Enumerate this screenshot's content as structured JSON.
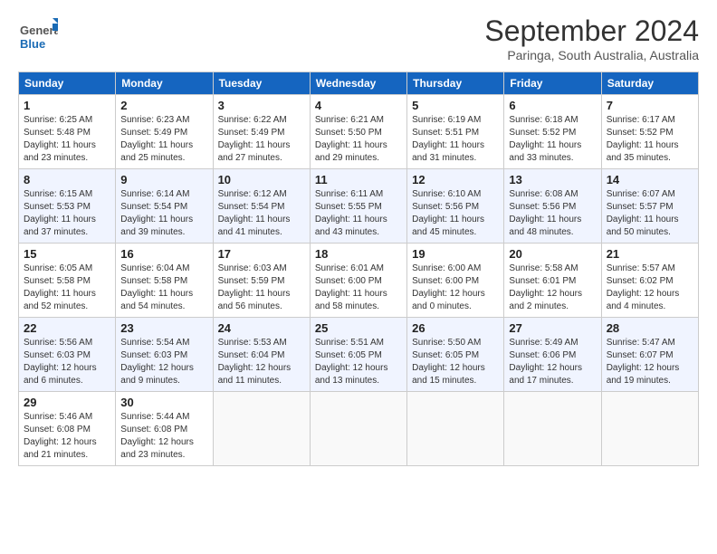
{
  "header": {
    "logo_general": "General",
    "logo_blue": "Blue",
    "month": "September 2024",
    "location": "Paringa, South Australia, Australia"
  },
  "days_of_week": [
    "Sunday",
    "Monday",
    "Tuesday",
    "Wednesday",
    "Thursday",
    "Friday",
    "Saturday"
  ],
  "weeks": [
    [
      {
        "day": "1",
        "sunrise": "6:25 AM",
        "sunset": "5:48 PM",
        "daylight": "11 hours and 23 minutes."
      },
      {
        "day": "2",
        "sunrise": "6:23 AM",
        "sunset": "5:49 PM",
        "daylight": "11 hours and 25 minutes."
      },
      {
        "day": "3",
        "sunrise": "6:22 AM",
        "sunset": "5:49 PM",
        "daylight": "11 hours and 27 minutes."
      },
      {
        "day": "4",
        "sunrise": "6:21 AM",
        "sunset": "5:50 PM",
        "daylight": "11 hours and 29 minutes."
      },
      {
        "day": "5",
        "sunrise": "6:19 AM",
        "sunset": "5:51 PM",
        "daylight": "11 hours and 31 minutes."
      },
      {
        "day": "6",
        "sunrise": "6:18 AM",
        "sunset": "5:52 PM",
        "daylight": "11 hours and 33 minutes."
      },
      {
        "day": "7",
        "sunrise": "6:17 AM",
        "sunset": "5:52 PM",
        "daylight": "11 hours and 35 minutes."
      }
    ],
    [
      {
        "day": "8",
        "sunrise": "6:15 AM",
        "sunset": "5:53 PM",
        "daylight": "11 hours and 37 minutes."
      },
      {
        "day": "9",
        "sunrise": "6:14 AM",
        "sunset": "5:54 PM",
        "daylight": "11 hours and 39 minutes."
      },
      {
        "day": "10",
        "sunrise": "6:12 AM",
        "sunset": "5:54 PM",
        "daylight": "11 hours and 41 minutes."
      },
      {
        "day": "11",
        "sunrise": "6:11 AM",
        "sunset": "5:55 PM",
        "daylight": "11 hours and 43 minutes."
      },
      {
        "day": "12",
        "sunrise": "6:10 AM",
        "sunset": "5:56 PM",
        "daylight": "11 hours and 45 minutes."
      },
      {
        "day": "13",
        "sunrise": "6:08 AM",
        "sunset": "5:56 PM",
        "daylight": "11 hours and 48 minutes."
      },
      {
        "day": "14",
        "sunrise": "6:07 AM",
        "sunset": "5:57 PM",
        "daylight": "11 hours and 50 minutes."
      }
    ],
    [
      {
        "day": "15",
        "sunrise": "6:05 AM",
        "sunset": "5:58 PM",
        "daylight": "11 hours and 52 minutes."
      },
      {
        "day": "16",
        "sunrise": "6:04 AM",
        "sunset": "5:58 PM",
        "daylight": "11 hours and 54 minutes."
      },
      {
        "day": "17",
        "sunrise": "6:03 AM",
        "sunset": "5:59 PM",
        "daylight": "11 hours and 56 minutes."
      },
      {
        "day": "18",
        "sunrise": "6:01 AM",
        "sunset": "6:00 PM",
        "daylight": "11 hours and 58 minutes."
      },
      {
        "day": "19",
        "sunrise": "6:00 AM",
        "sunset": "6:00 PM",
        "daylight": "12 hours and 0 minutes."
      },
      {
        "day": "20",
        "sunrise": "5:58 AM",
        "sunset": "6:01 PM",
        "daylight": "12 hours and 2 minutes."
      },
      {
        "day": "21",
        "sunrise": "5:57 AM",
        "sunset": "6:02 PM",
        "daylight": "12 hours and 4 minutes."
      }
    ],
    [
      {
        "day": "22",
        "sunrise": "5:56 AM",
        "sunset": "6:03 PM",
        "daylight": "12 hours and 6 minutes."
      },
      {
        "day": "23",
        "sunrise": "5:54 AM",
        "sunset": "6:03 PM",
        "daylight": "12 hours and 9 minutes."
      },
      {
        "day": "24",
        "sunrise": "5:53 AM",
        "sunset": "6:04 PM",
        "daylight": "12 hours and 11 minutes."
      },
      {
        "day": "25",
        "sunrise": "5:51 AM",
        "sunset": "6:05 PM",
        "daylight": "12 hours and 13 minutes."
      },
      {
        "day": "26",
        "sunrise": "5:50 AM",
        "sunset": "6:05 PM",
        "daylight": "12 hours and 15 minutes."
      },
      {
        "day": "27",
        "sunrise": "5:49 AM",
        "sunset": "6:06 PM",
        "daylight": "12 hours and 17 minutes."
      },
      {
        "day": "28",
        "sunrise": "5:47 AM",
        "sunset": "6:07 PM",
        "daylight": "12 hours and 19 minutes."
      }
    ],
    [
      {
        "day": "29",
        "sunrise": "5:46 AM",
        "sunset": "6:08 PM",
        "daylight": "12 hours and 21 minutes."
      },
      {
        "day": "30",
        "sunrise": "5:44 AM",
        "sunset": "6:08 PM",
        "daylight": "12 hours and 23 minutes."
      },
      null,
      null,
      null,
      null,
      null
    ]
  ],
  "labels": {
    "sunrise": "Sunrise: ",
    "sunset": "Sunset: ",
    "daylight": "Daylight: "
  }
}
